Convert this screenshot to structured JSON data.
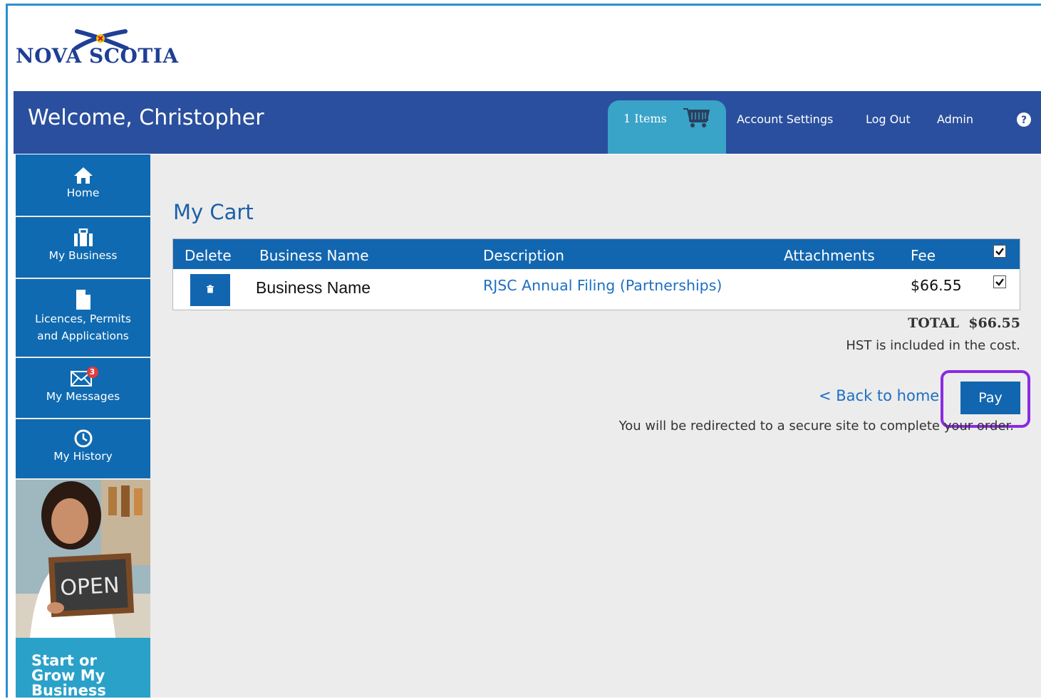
{
  "brand": {
    "logo_text": "NOVA SCOTIA"
  },
  "header": {
    "welcome": "Welcome, Christopher",
    "cart_label": "1 Items",
    "links": {
      "account_settings": "Account Settings",
      "log_out": "Log Out",
      "admin": "Admin"
    },
    "help_icon": "question-circle-icon"
  },
  "sidebar": {
    "items": [
      {
        "label": "Home",
        "icon": "home-icon"
      },
      {
        "label": "My Business",
        "icon": "briefcase-icon"
      },
      {
        "label_line1": "Licences, Permits",
        "label_line2": "and Applications",
        "icon": "document-icon"
      },
      {
        "label": "My Messages",
        "icon": "envelope-icon",
        "badge": "3"
      },
      {
        "label": "My History",
        "icon": "clock-icon"
      }
    ],
    "promo_sign": "OPEN",
    "promo_line1": "Start or",
    "promo_line2": "Grow My",
    "promo_line3": "Business"
  },
  "main": {
    "title": "My Cart",
    "table": {
      "headers": {
        "delete": "Delete",
        "business_name": "Business Name",
        "description": "Description",
        "attachments": "Attachments",
        "fee": "Fee"
      },
      "header_checked": true,
      "rows": [
        {
          "business_name": "Business Name",
          "description": "RJSC Annual Filing (Partnerships)",
          "fee": "$66.55",
          "checked": true
        }
      ]
    },
    "total_label": "TOTAL",
    "total_value": "$66.55",
    "hst_note": "HST is included in the cost.",
    "back_link": "< Back to home",
    "pay_button": "Pay",
    "redirect_note": "You will be redirected to a secure site to complete your order."
  },
  "colors": {
    "header_blue": "#2a4f9e",
    "nav_blue": "#0f6ab1",
    "cart_tab": "#3aa3c8",
    "link_blue": "#1d6fc2",
    "highlight": "#8a2be2"
  }
}
